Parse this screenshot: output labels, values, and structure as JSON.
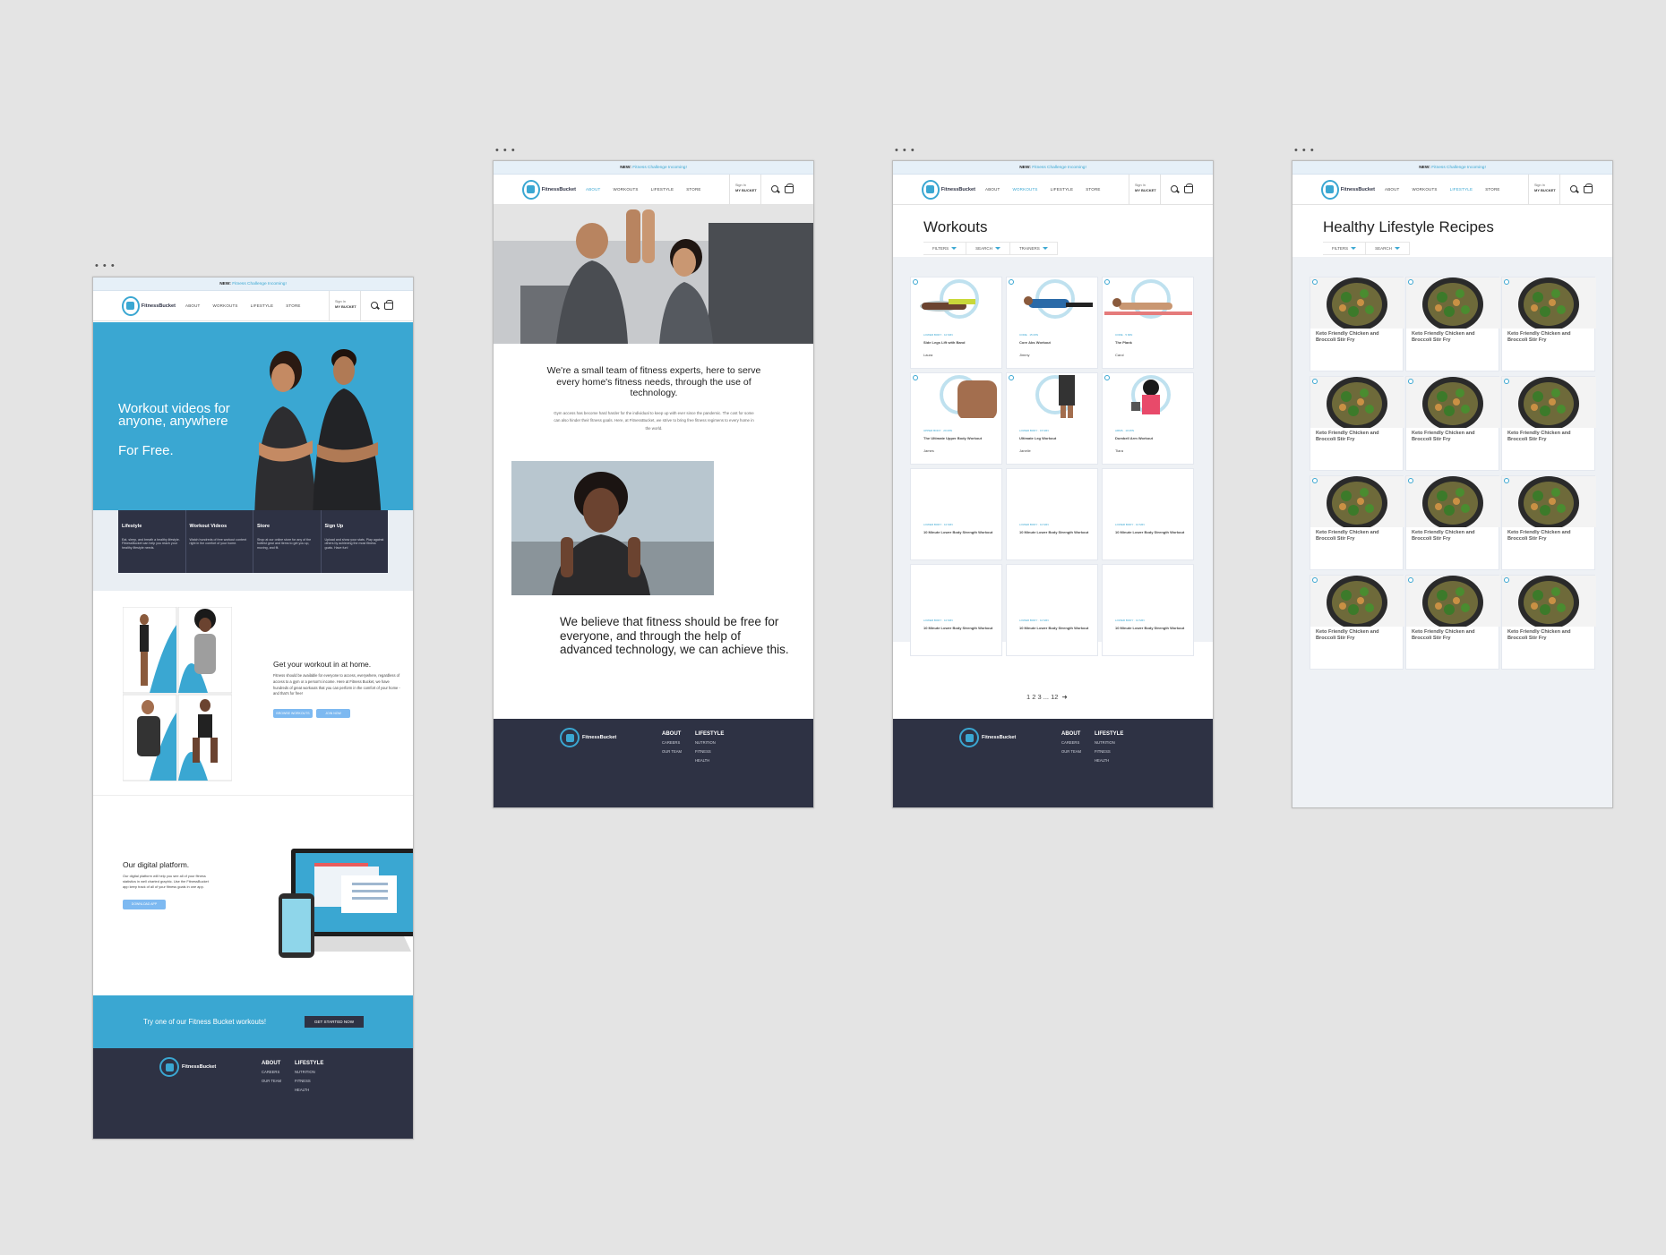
{
  "brand": {
    "name": "FitnessBucket",
    "accent": "#3aa7d2",
    "dark": "#2e3244",
    "button": "#7db9f1"
  },
  "banner": {
    "new": "NEW:",
    "text": "Fitness Challenge Incoming!"
  },
  "nav": {
    "items": [
      "ABOUT",
      "WORKOUTS",
      "LIFESTYLE",
      "STORE"
    ],
    "bucket_top": "Sign In",
    "bucket_label": "MY BUCKET"
  },
  "frame_menu": "• • •",
  "home": {
    "hero_line1": "Workout videos for",
    "hero_line2": "anyone, anywhere",
    "hero_free": "For Free.",
    "cards": [
      {
        "title": "Lifestyle",
        "text": "Eat, sleep, and breath a healthy lifestyle. FitnessBucket can help you reach your healthy lifestyle needs."
      },
      {
        "title": "Workout Videos",
        "text": "Watch hundreds of free workout content right in the comfort of your home."
      },
      {
        "title": "Store",
        "text": "Shop at our online store for any of the hottest gear and items to get you up, moving, and fit."
      },
      {
        "title": "Sign Up",
        "text": "Upload and show your stats. Play against others by achieving the most fitness goals. Have fun!"
      }
    ],
    "home_title": "Get your workout in at home.",
    "home_text": "Fitness should be available for everyone to access, everywhere, regardless of access to a gym or a person's income. Here at Fitness Bucket, we have hundreds of great workouts that you can perform in the comfort of your home - and that's for free!",
    "home_btn1": "BROWSE WORKOUTS",
    "home_btn2": "JOIN NOW",
    "digital_title": "Our digital platform.",
    "digital_text": "Our digital platform will help you see all of your fitness statistics in well charted graphic. Use the FitnessBucket app keep track of all of your fitness goals in one app.",
    "digital_btn": "DOWNLOAD APP",
    "cta_text": "Try one of our Fitness Bucket workouts!",
    "cta_btn": "GET STARTED NOW"
  },
  "footer": {
    "col1_title": "ABOUT",
    "col1_items": [
      "CAREERS",
      "OUR TEAM"
    ],
    "col2_title": "LIFESTYLE",
    "col2_items": [
      "NUTRITION",
      "FITNESS",
      "HEALTH"
    ]
  },
  "about": {
    "intro": "We're a small team of fitness experts, here to serve every home's fitness needs, through the use of technology.",
    "body": "Gym access has become hard harder for the individual to keep up with ever since the pandemic. The cost for some can also hinder their fitness goals. Here, at FitnessBucket, we strive to bring free fitness regimens to every home in the world.",
    "belief": "We believe that fitness should be free for everyone, and through the help of advanced technology, we can achieve this."
  },
  "workouts": {
    "title": "Workouts",
    "filters": [
      "FILTERS",
      "SEARCH",
      "TRAINERS"
    ],
    "tiles": [
      {
        "tag": "LOWER BODY · 10 MIN",
        "title": "Side Legs Lift with Band",
        "trainer": "Laura"
      },
      {
        "tag": "CORE · 15 MIN",
        "title": "Core Abs Workout",
        "trainer": "Jimmy"
      },
      {
        "tag": "CORE · 5 MIN",
        "title": "The Plank",
        "trainer": "Carol"
      },
      {
        "tag": "UPPER BODY · 20 MIN",
        "title": "The Ultimate Upper Body Workout",
        "trainer": "James"
      },
      {
        "tag": "LOWER BODY · 15 MIN",
        "title": "Ultimate Leg Workout",
        "trainer": "Janelle"
      },
      {
        "tag": "ARMS · 10 MIN",
        "title": "Dumbell Arm Workout",
        "trainer": "Tiara"
      },
      {
        "tag": "LOWER BODY · 10 MIN",
        "title": "10 Minute Lower Body Strength Workout",
        "trainer": ""
      },
      {
        "tag": "LOWER BODY · 10 MIN",
        "title": "10 Minute Lower Body Strength Workout",
        "trainer": ""
      },
      {
        "tag": "LOWER BODY · 10 MIN",
        "title": "10 Minute Lower Body Strength Workout",
        "trainer": ""
      },
      {
        "tag": "LOWER BODY · 10 MIN",
        "title": "10 Minute Lower Body Strength Workout",
        "trainer": ""
      },
      {
        "tag": "LOWER BODY · 10 MIN",
        "title": "10 Minute Lower Body Strength Workout",
        "trainer": ""
      },
      {
        "tag": "LOWER BODY · 10 MIN",
        "title": "10 Minute Lower Body Strength Workout",
        "trainer": ""
      }
    ],
    "pagination": "1 2 3 ... 12"
  },
  "recipes": {
    "title": "Healthy Lifestyle Recipes",
    "filters": [
      "FILTERS",
      "SEARCH"
    ],
    "item_title": "Keto Friendly Chicken and Broccoli Stir Fry",
    "count": 12
  }
}
